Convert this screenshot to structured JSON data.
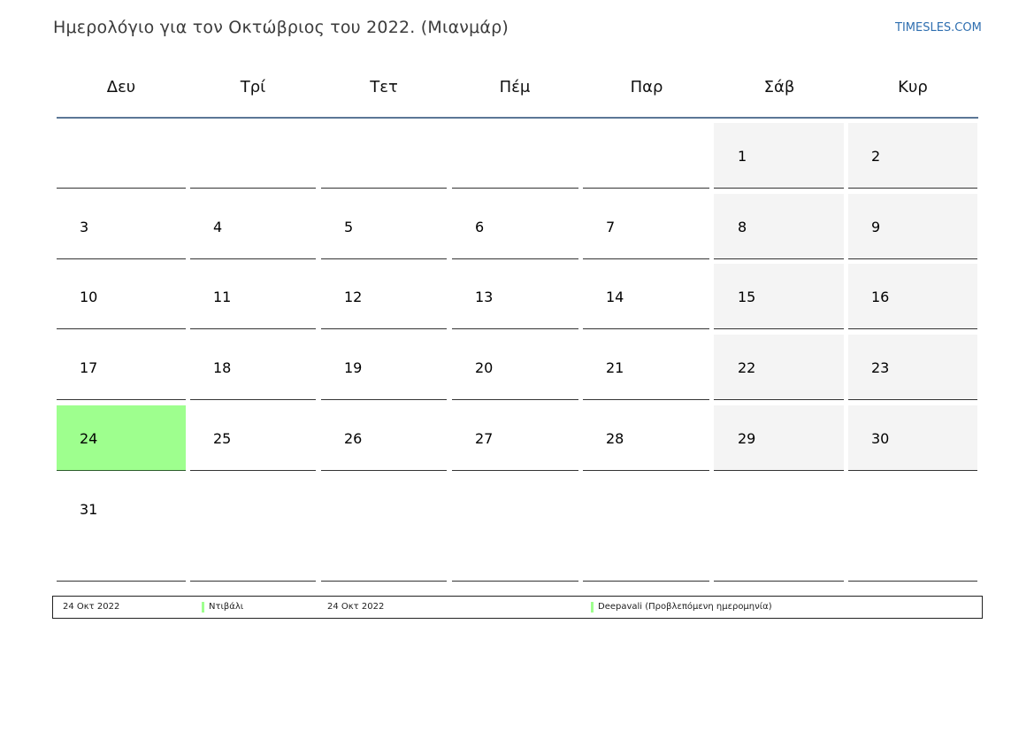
{
  "header": {
    "title": "Ημερολόγιο για τον Οκτώβριος του 2022. (Μιανμάρ)",
    "site": "TIMESLES.COM"
  },
  "weekdays": [
    "Δευ",
    "Τρί",
    "Τετ",
    "Πέμ",
    "Παρ",
    "Σάβ",
    "Κυρ"
  ],
  "weeks": [
    [
      "",
      "",
      "",
      "",
      "",
      "1",
      "2"
    ],
    [
      "3",
      "4",
      "5",
      "6",
      "7",
      "8",
      "9"
    ],
    [
      "10",
      "11",
      "12",
      "13",
      "14",
      "15",
      "16"
    ],
    [
      "17",
      "18",
      "19",
      "20",
      "21",
      "22",
      "23"
    ],
    [
      "24",
      "25",
      "26",
      "27",
      "28",
      "29",
      "30"
    ],
    [
      "31",
      "",
      "",
      "",
      "",
      "",
      ""
    ]
  ],
  "highlight_day": "24",
  "colors": {
    "holiday": "#9eff8e",
    "weekend": "#f4f4f4",
    "header_rule": "#5b7796",
    "site_link": "#2f6fb0"
  },
  "holidays": [
    {
      "date": "24 Οκτ 2022",
      "name": "Ντιβάλι"
    },
    {
      "date": "24 Οκτ 2022",
      "name": "Deepavali (Προβλεπόμενη ημερομηνία)"
    }
  ]
}
